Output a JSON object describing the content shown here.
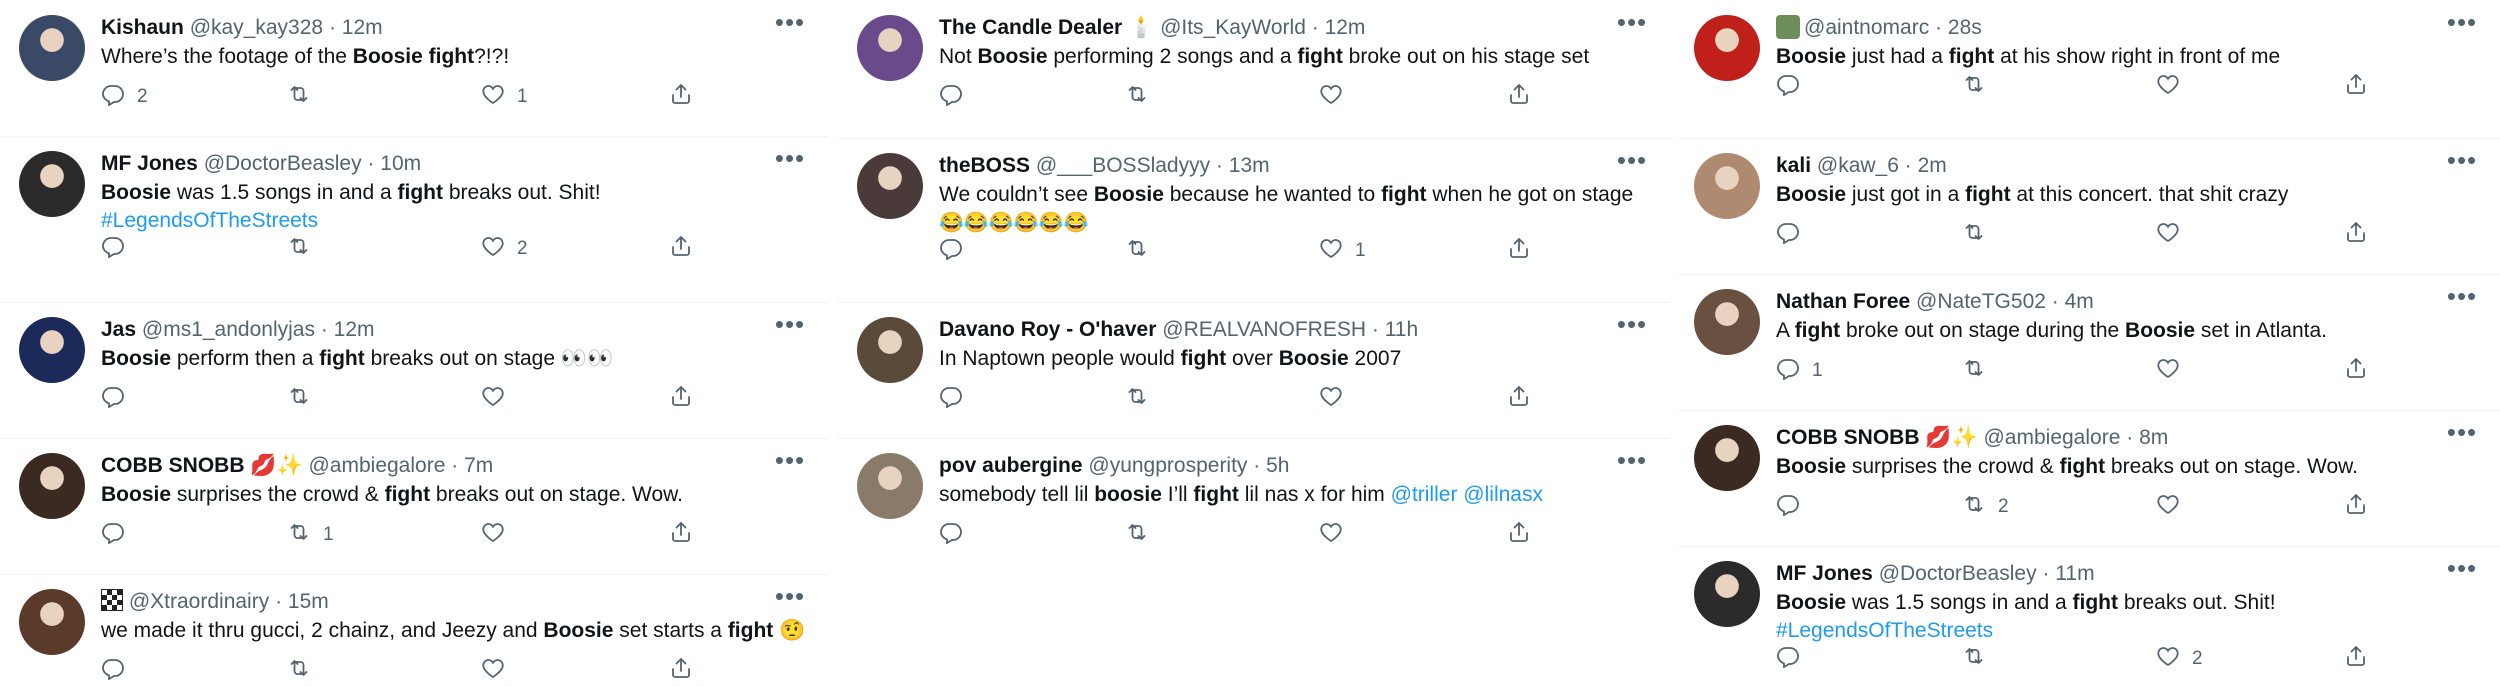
{
  "columns": [
    {
      "tweets": [
        {
          "name": "Kishaun",
          "handle": "@kay_kay328",
          "time": "12m",
          "dot": "·",
          "body": [
            {
              "t": "Where’s the footage of the "
            },
            {
              "t": "Boosie",
              "b": true
            },
            {
              "t": " "
            },
            {
              "t": "fight",
              "b": true
            },
            {
              "t": "?!?!"
            }
          ],
          "replies": "2",
          "retweets": "",
          "likes": "1",
          "avatar_color": "#3a4a66"
        },
        {
          "name": "MF Jones",
          "handle": "@DoctorBeasley",
          "time": "10m",
          "dot": "·",
          "body": [
            {
              "t": "Boosie",
              "b": true
            },
            {
              "t": " was 1.5 songs in and a "
            },
            {
              "t": "fight",
              "b": true
            },
            {
              "t": " breaks out. Shit!"
            }
          ],
          "body2": "#LegendsOfTheStreets",
          "replies": "",
          "retweets": "",
          "likes": "2",
          "avatar_color": "#2b2b2b"
        },
        {
          "name": "Jas",
          "handle": "@ms1_andonlyjas",
          "time": "12m",
          "dot": "·",
          "body": [
            {
              "t": "Boosie",
              "b": true
            },
            {
              "t": " perform then a "
            },
            {
              "t": "fight",
              "b": true
            },
            {
              "t": " breaks out on stage 👀👀"
            }
          ],
          "replies": "",
          "retweets": "",
          "likes": "",
          "avatar_color": "#1c2a5a"
        },
        {
          "name": "COBB SNOBB 💋✨",
          "handle": "@ambiegalore",
          "time": "7m",
          "dot": "·",
          "body": [
            {
              "t": "Boosie",
              "b": true
            },
            {
              "t": " surprises the crowd & "
            },
            {
              "t": "fight",
              "b": true
            },
            {
              "t": " breaks out on stage. Wow."
            }
          ],
          "replies": "",
          "retweets": "1",
          "likes": "",
          "avatar_color": "#3b2a22"
        },
        {
          "name": "",
          "handle": "@Xtraordinairy",
          "time": "15m",
          "dot": "·",
          "body": [
            {
              "t": "we made it thru gucci, 2 chainz, and Jeezy and "
            },
            {
              "t": "Boosie",
              "b": true
            },
            {
              "t": " set starts a "
            },
            {
              "t": "fight",
              "b": true
            },
            {
              "t": " 🤨"
            }
          ],
          "replies": "",
          "retweets": "",
          "likes": "",
          "avatar_color": "#5a3a2a"
        }
      ]
    },
    {
      "tweets": [
        {
          "name": "The Candle Dealer 🕯️",
          "handle": "@Its_KayWorld",
          "time": "12m",
          "dot": "·",
          "body": [
            {
              "t": "Not "
            },
            {
              "t": "Boosie",
              "b": true
            },
            {
              "t": " performing 2 songs and a "
            },
            {
              "t": "fight",
              "b": true
            },
            {
              "t": " broke out on his stage set"
            }
          ],
          "replies": "",
          "retweets": "",
          "likes": "",
          "avatar_color": "#6a4a8a"
        },
        {
          "name": "theBOSS",
          "handle": "@___BOSSladyyy",
          "time": "13m",
          "dot": "·",
          "body": [
            {
              "t": "We couldn’t see "
            },
            {
              "t": "Boosie",
              "b": true
            },
            {
              "t": " because he wanted to "
            },
            {
              "t": "fight",
              "b": true
            },
            {
              "t": " when he got on stage"
            }
          ],
          "body2": "😂😂😂😂😂😂",
          "replies": "",
          "retweets": "",
          "likes": "1",
          "avatar_color": "#4a3a3a"
        },
        {
          "name": "Davano Roy - O'haver",
          "handle": "@REALVANOFRESH",
          "time": "11h",
          "dot": "·",
          "body": [
            {
              "t": "In Naptown people would "
            },
            {
              "t": "fight",
              "b": true
            },
            {
              "t": " over "
            },
            {
              "t": "Boosie",
              "b": true
            },
            {
              "t": " 2007"
            }
          ],
          "replies": "",
          "retweets": "",
          "likes": "",
          "avatar_color": "#5a4a3a"
        },
        {
          "name": "pov aubergine",
          "handle": "@yungprosperity",
          "time": "5h",
          "dot": "·",
          "body": [
            {
              "t": "somebody tell lil "
            },
            {
              "t": "boosie",
              "b": true
            },
            {
              "t": " I’ll "
            },
            {
              "t": "fight",
              "b": true
            },
            {
              "t": " lil nas x for him "
            },
            {
              "t": "@triller",
              "link": true
            },
            {
              "t": " "
            },
            {
              "t": "@lilnasx",
              "link": true
            }
          ],
          "replies": "",
          "retweets": "",
          "likes": "",
          "avatar_color": "#8a7a6a"
        }
      ]
    },
    {
      "tweets": [
        {
          "name": "",
          "handle": "@aintnomarc",
          "time": "28s",
          "dot": "·",
          "body": [
            {
              "t": "Boosie",
              "b": true
            },
            {
              "t": " just had a "
            },
            {
              "t": "fight",
              "b": true
            },
            {
              "t": " at his show right in front of me"
            }
          ],
          "replies": "",
          "retweets": "",
          "likes": "",
          "avatar_color": "#c0201a"
        },
        {
          "name": "kali",
          "handle": "@kaw_6",
          "time": "2m",
          "dot": "·",
          "body": [
            {
              "t": "Boosie",
              "b": true
            },
            {
              "t": " just got in a "
            },
            {
              "t": "fight",
              "b": true
            },
            {
              "t": " at this concert. that shit crazy"
            }
          ],
          "replies": "",
          "retweets": "",
          "likes": "",
          "avatar_color": "#b08a70"
        },
        {
          "name": "Nathan Foree",
          "handle": "@NateTG502",
          "time": "4m",
          "dot": "·",
          "body": [
            {
              "t": "A "
            },
            {
              "t": "fight",
              "b": true
            },
            {
              "t": " broke out on stage during the "
            },
            {
              "t": "Boosie",
              "b": true
            },
            {
              "t": " set in Atlanta."
            }
          ],
          "replies": "1",
          "retweets": "",
          "likes": "",
          "avatar_color": "#6a5040"
        },
        {
          "name": "COBB SNOBB 💋✨",
          "handle": "@ambiegalore",
          "time": "8m",
          "dot": "·",
          "body": [
            {
              "t": "Boosie",
              "b": true
            },
            {
              "t": " surprises the crowd & "
            },
            {
              "t": "fight",
              "b": true
            },
            {
              "t": " breaks out on stage. Wow."
            }
          ],
          "replies": "",
          "retweets": "2",
          "likes": "",
          "avatar_color": "#3b2a22"
        },
        {
          "name": "MF Jones",
          "handle": "@DoctorBeasley",
          "time": "11m",
          "dot": "·",
          "body": [
            {
              "t": "Boosie",
              "b": true
            },
            {
              "t": " was 1.5 songs in and a "
            },
            {
              "t": "fight",
              "b": true
            },
            {
              "t": " breaks out. Shit!"
            }
          ],
          "body2": "#LegendsOfTheStreets",
          "replies": "",
          "retweets": "",
          "likes": "2",
          "avatar_color": "#2b2b2b"
        }
      ]
    }
  ],
  "more_glyph": "•••",
  "colors": {
    "text": "#0f1419",
    "muted": "#536471",
    "link": "#1d9bf0",
    "divider": "#eff3f4"
  }
}
